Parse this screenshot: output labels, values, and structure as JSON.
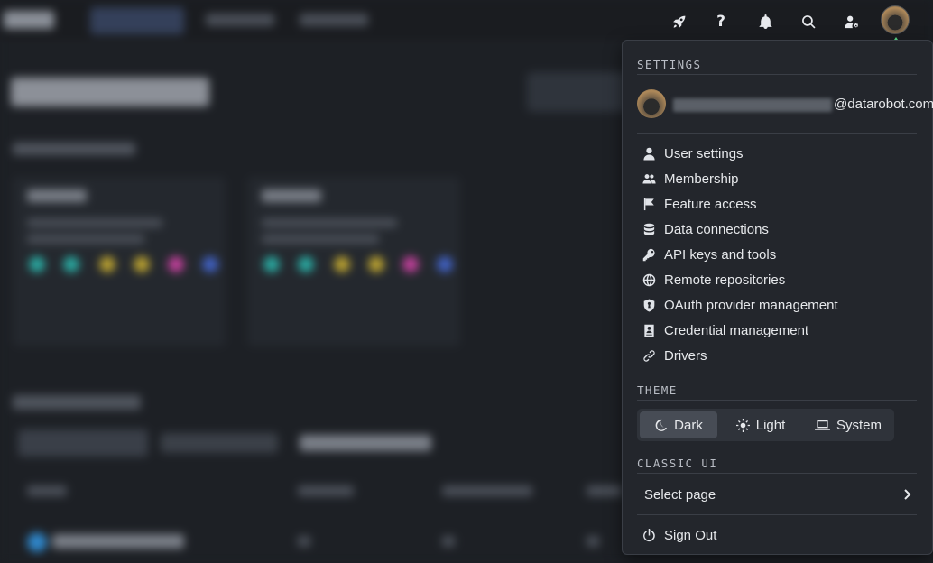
{
  "dropdown": {
    "settings_heading": "SETTINGS",
    "user_email_domain": "@datarobot.com",
    "menu_items": [
      {
        "label": "User settings",
        "icon": "user-icon"
      },
      {
        "label": "Membership",
        "icon": "users-icon"
      },
      {
        "label": "Feature access",
        "icon": "flag-icon"
      },
      {
        "label": "Data connections",
        "icon": "database-icon"
      },
      {
        "label": "API keys and tools",
        "icon": "key-icon"
      },
      {
        "label": "Remote repositories",
        "icon": "globe-icon"
      },
      {
        "label": "OAuth provider management",
        "icon": "shield-icon"
      },
      {
        "label": "Credential management",
        "icon": "credential-book-icon"
      },
      {
        "label": "Drivers",
        "icon": "link-icon"
      }
    ],
    "theme_heading": "THEME",
    "theme_options": [
      {
        "label": "Dark",
        "icon": "moon-icon",
        "selected": true
      },
      {
        "label": "Light",
        "icon": "sun-icon",
        "selected": false
      },
      {
        "label": "System",
        "icon": "laptop-icon",
        "selected": false
      }
    ],
    "classic_ui_heading": "CLASSIC UI",
    "select_page_label": "Select page",
    "sign_out_label": "Sign Out"
  },
  "topbar": {
    "icons": [
      "rocket-icon",
      "help-icon",
      "bell-icon",
      "search-icon",
      "user-settings-icon",
      "avatar"
    ],
    "help_glyph": "?"
  },
  "colors": {
    "panel_bg": "#23262c",
    "accent_arrow": "#5ee08a",
    "active_theme_bg": "#474c55"
  }
}
